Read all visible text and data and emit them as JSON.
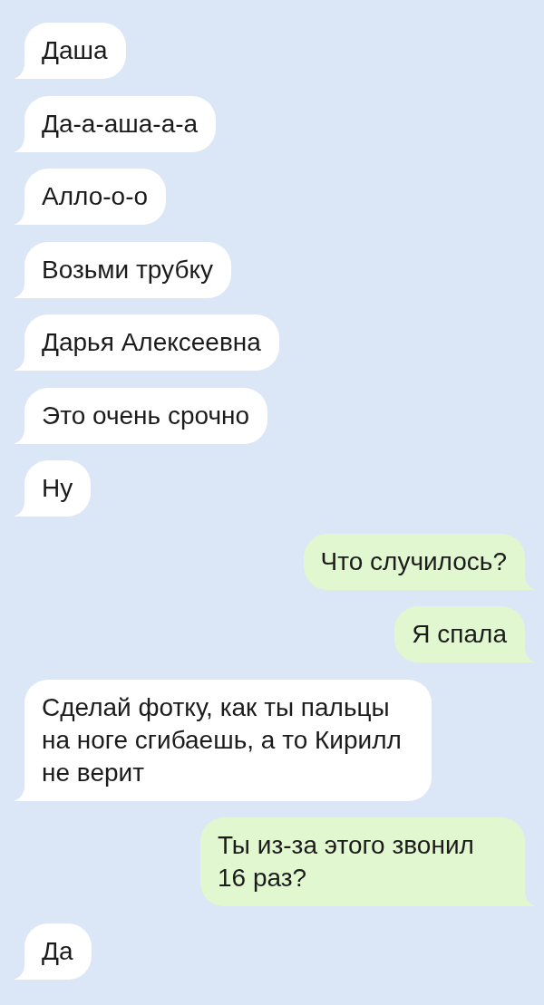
{
  "chat": {
    "messages": [
      {
        "kind": "incoming",
        "text": "Даша"
      },
      {
        "kind": "incoming",
        "text": "Да-а-аша-а-а"
      },
      {
        "kind": "incoming",
        "text": "Алло-о-о"
      },
      {
        "kind": "incoming",
        "text": "Возьми трубку"
      },
      {
        "kind": "incoming",
        "text": "Дарья Алексеевна"
      },
      {
        "kind": "incoming",
        "text": "Это очень срочно"
      },
      {
        "kind": "incoming",
        "text": "Ну"
      },
      {
        "kind": "outgoing",
        "text": "Что случилось?"
      },
      {
        "kind": "outgoing",
        "text": "Я спала"
      },
      {
        "kind": "incoming",
        "text": "Сделай фотку, как ты пальцы на ноге сгибаешь, а то Кирилл не верит"
      },
      {
        "kind": "outgoing",
        "text": "Ты из-за этого звонил 16 раз?"
      },
      {
        "kind": "incoming",
        "text": "Да"
      }
    ]
  }
}
